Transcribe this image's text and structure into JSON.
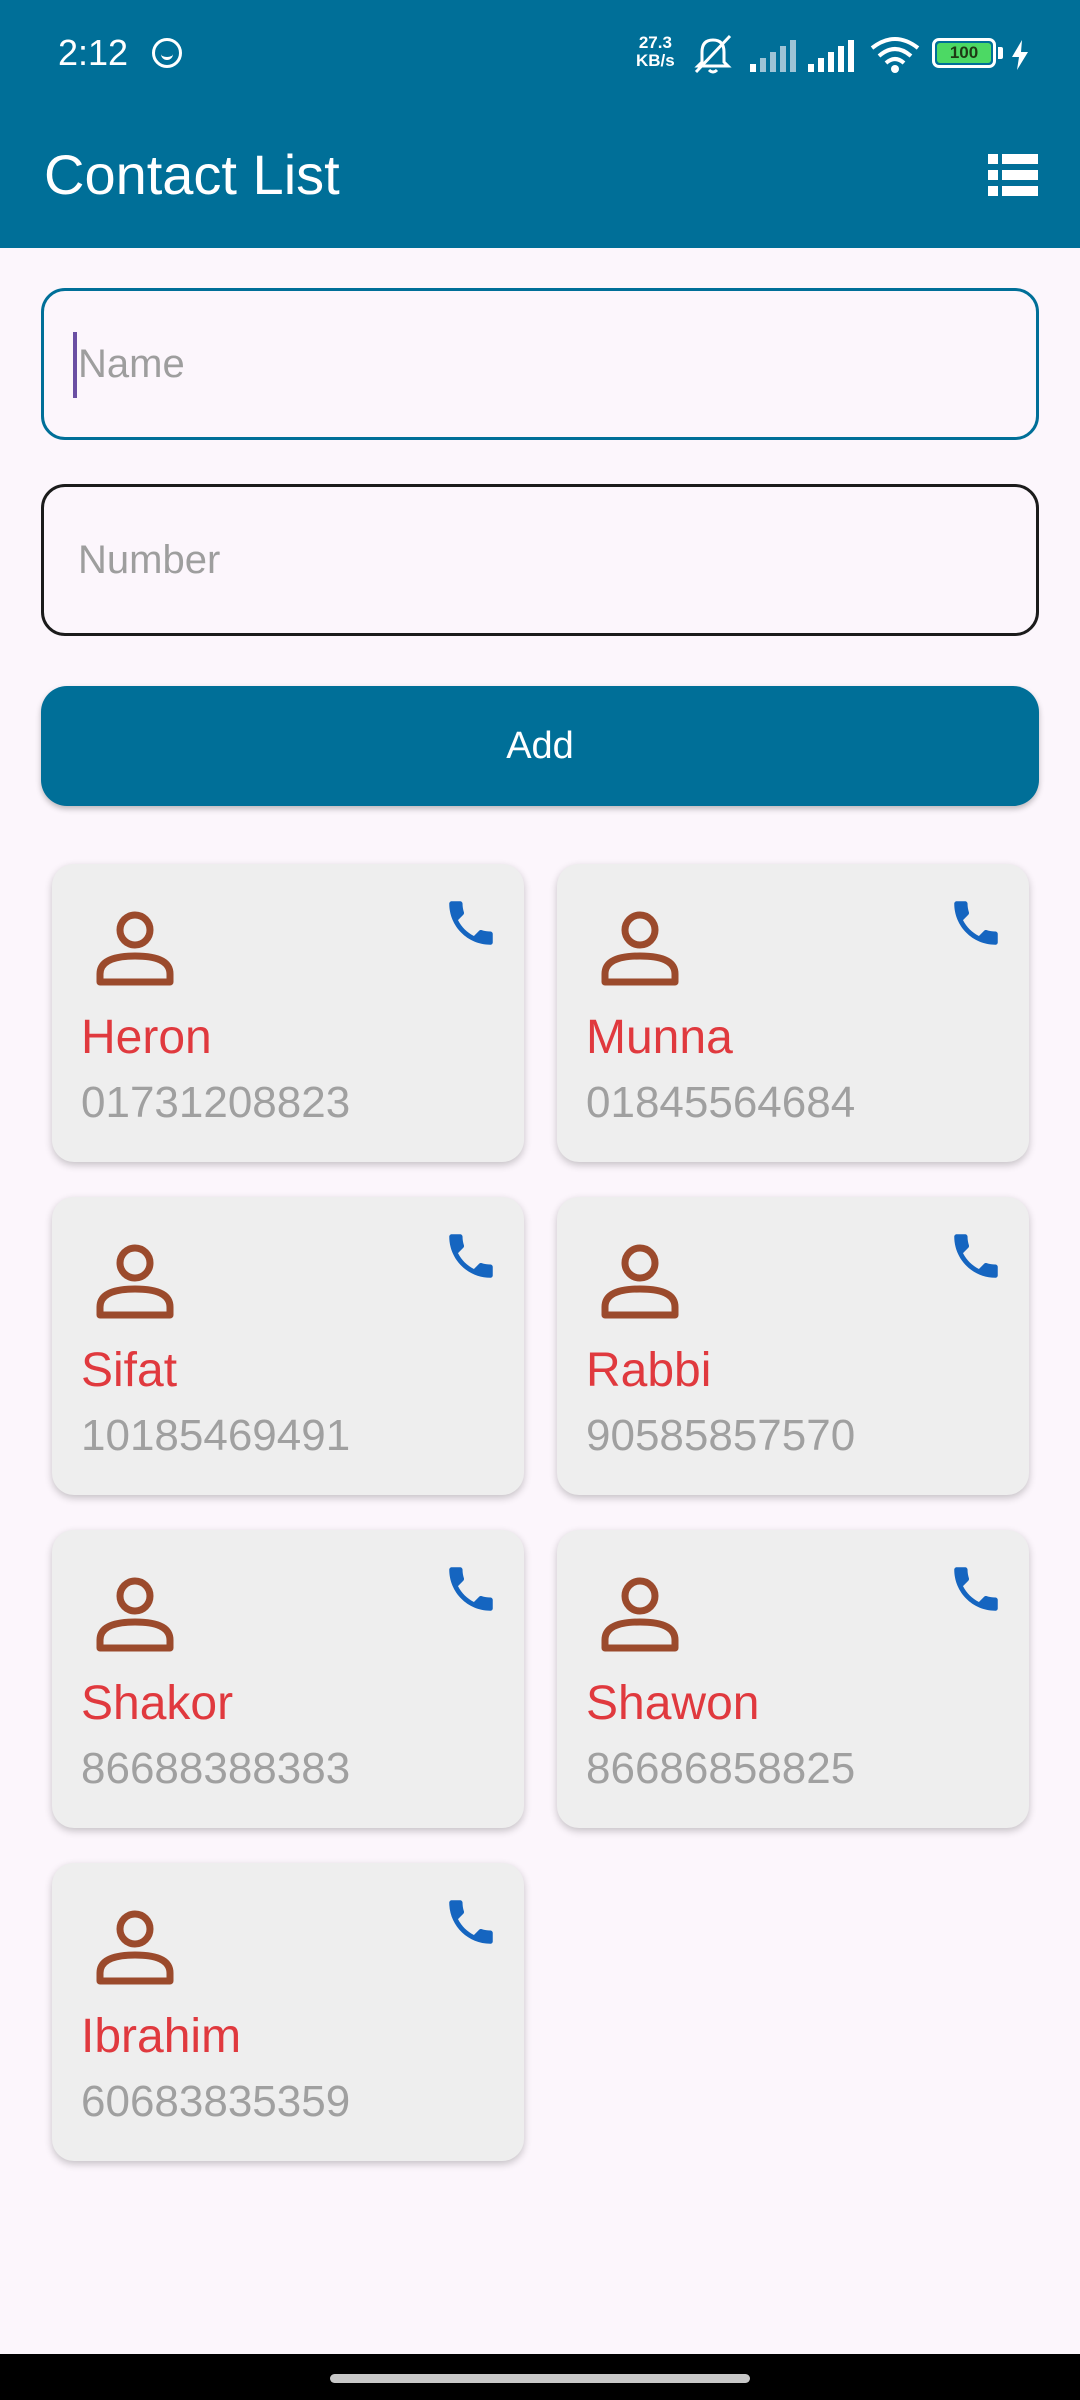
{
  "status_bar": {
    "time": "2:12",
    "speed_value": "27.3",
    "speed_unit": "KB/s",
    "battery": "100"
  },
  "app_bar": {
    "title": "Contact List",
    "menu_icon": "list-icon"
  },
  "form": {
    "name_placeholder": "Name",
    "name_value": "",
    "number_placeholder": "Number",
    "number_value": "",
    "add_label": "Add"
  },
  "colors": {
    "primary": "#006f98",
    "contact_name": "#e0393e",
    "contact_number": "#a0a0a0",
    "person_icon": "#9b4a2c",
    "phone_icon": "#1565c0",
    "card_bg": "#eeeeee",
    "page_bg": "#fcf6fc"
  },
  "contacts": [
    {
      "name": "Heron",
      "number": "01731208823"
    },
    {
      "name": "Munna",
      "number": "01845564684"
    },
    {
      "name": "Sifat",
      "number": "10185469491"
    },
    {
      "name": "Rabbi",
      "number": "90585857570"
    },
    {
      "name": "Shakor",
      "number": "86688388383"
    },
    {
      "name": "Shawon",
      "number": "86686858825"
    },
    {
      "name": "Ibrahim",
      "number": "60683835359"
    }
  ]
}
